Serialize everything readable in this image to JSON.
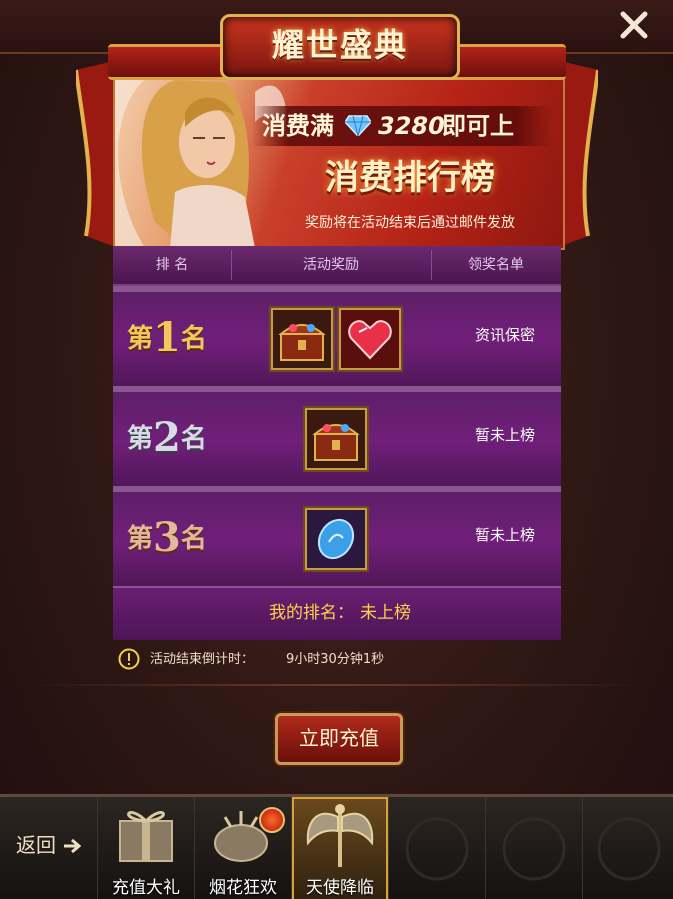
{
  "header": {
    "title": "耀世盛典",
    "close_icon": "close-icon"
  },
  "banner": {
    "spend_prefix": "消费满",
    "diamond_icon": "diamond-icon",
    "spend_amount": "3280",
    "spend_suffix": "即可上",
    "title": "消费排行榜",
    "note": "奖励将在活动结束后通过邮件发放"
  },
  "table": {
    "headers": [
      "排 名",
      "活动奖励",
      "领奖名单"
    ],
    "rows": [
      {
        "rank_prefix": "第",
        "rank_num": "1",
        "rank_suffix": "名",
        "rewards": [
          "treasure-chest-icon",
          "ruby-heart-icon"
        ],
        "winner": "资讯保密"
      },
      {
        "rank_prefix": "第",
        "rank_num": "2",
        "rank_suffix": "名",
        "rewards": [
          "treasure-chest-icon"
        ],
        "winner": "暂未上榜"
      },
      {
        "rank_prefix": "第",
        "rank_num": "3",
        "rank_suffix": "名",
        "rewards": [
          "blue-gem-icon"
        ],
        "winner": "暂未上榜"
      }
    ],
    "my_rank_label": "我的排名：",
    "my_rank_value": "未上榜"
  },
  "timer": {
    "label": "活动结束倒计时：",
    "value": "9小时30分钟1秒"
  },
  "recharge_button": "立即充值",
  "nav": {
    "back_label": "返回",
    "tabs": [
      {
        "label": "充值大礼",
        "icon": "gift-box-icon"
      },
      {
        "label": "烟花狂欢",
        "icon": "fireworks-icon"
      },
      {
        "label": "天使降临",
        "icon": "angel-wings-icon"
      }
    ]
  },
  "colors": {
    "accent_gold": "#f4c75a",
    "panel_purple": "#711f7a",
    "banner_red": "#b52216",
    "my_rank_yellow": "#ffd24a"
  }
}
